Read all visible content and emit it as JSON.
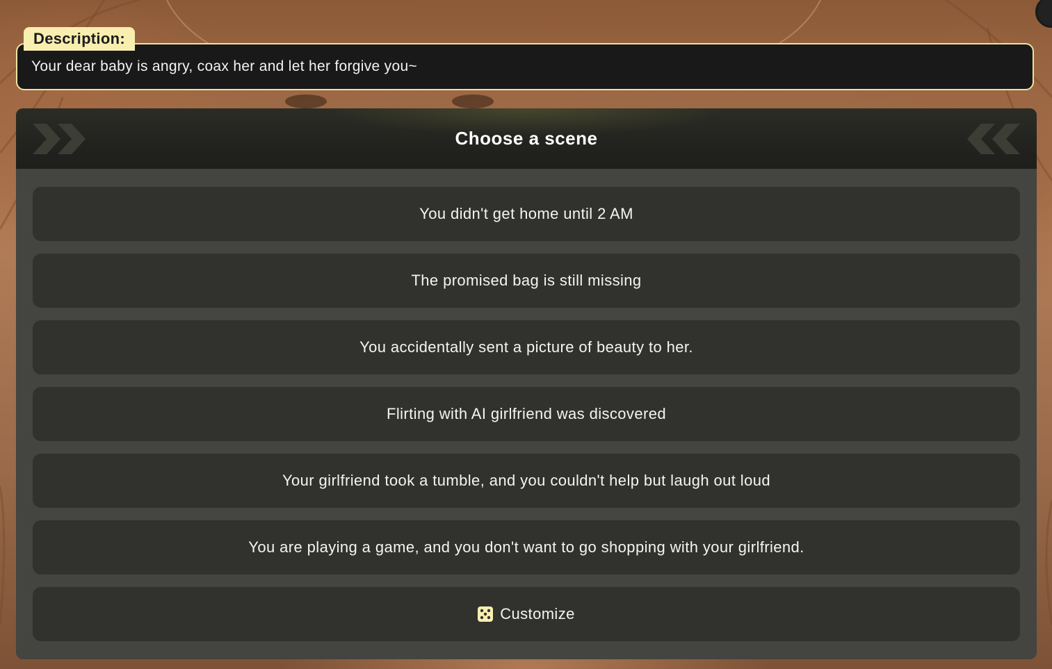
{
  "description": {
    "tag": "Description:",
    "text": "Your dear baby is angry, coax her and let her forgive you~"
  },
  "panel": {
    "title": "Choose a scene",
    "options": [
      "You didn't get home until 2 AM",
      "The promised bag is still missing",
      "You accidentally sent a picture of beauty to her.",
      "Flirting with AI girlfriend was discovered",
      "Your girlfriend took a tumble, and you couldn't help but laugh out loud",
      "You are playing a game, and you don't want to go shopping with your girlfriend."
    ],
    "customize_label": "Customize",
    "customize_icon": "dice-icon"
  },
  "colors": {
    "accent": "#f8eeb0",
    "panel_bg": "#444440",
    "option_bg": "#31312d",
    "header_bg": "#1e1e1c"
  }
}
